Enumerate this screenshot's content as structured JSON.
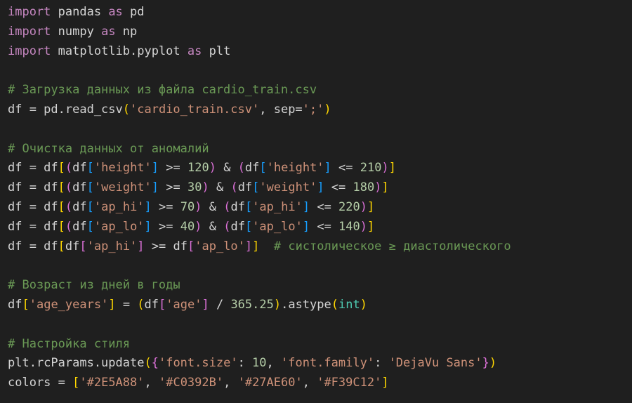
{
  "code": {
    "language": "python",
    "lines": [
      [
        {
          "t": "import",
          "c": "kw"
        },
        {
          "t": " pandas ",
          "c": "id"
        },
        {
          "t": "as",
          "c": "kw"
        },
        {
          "t": " pd",
          "c": "id"
        }
      ],
      [
        {
          "t": "import",
          "c": "kw"
        },
        {
          "t": " numpy ",
          "c": "id"
        },
        {
          "t": "as",
          "c": "kw"
        },
        {
          "t": " np",
          "c": "id"
        }
      ],
      [
        {
          "t": "import",
          "c": "kw"
        },
        {
          "t": " matplotlib.pyplot ",
          "c": "id"
        },
        {
          "t": "as",
          "c": "kw"
        },
        {
          "t": " plt",
          "c": "id"
        }
      ],
      [],
      [
        {
          "t": "# Загрузка данных из файла cardio_train.csv",
          "c": "cm"
        }
      ],
      [
        {
          "t": "df = pd.read_csv",
          "c": "id"
        },
        {
          "t": "(",
          "c": "b1"
        },
        {
          "t": "'cardio_train.csv'",
          "c": "str"
        },
        {
          "t": ", sep=",
          "c": "id"
        },
        {
          "t": "';'",
          "c": "str"
        },
        {
          "t": ")",
          "c": "b1"
        }
      ],
      [],
      [
        {
          "t": "# Очистка данных от аномалий",
          "c": "cm"
        }
      ],
      [
        {
          "t": "df = df",
          "c": "id"
        },
        {
          "t": "[",
          "c": "b1"
        },
        {
          "t": "(",
          "c": "b2"
        },
        {
          "t": "df",
          "c": "id"
        },
        {
          "t": "[",
          "c": "b3"
        },
        {
          "t": "'height'",
          "c": "str"
        },
        {
          "t": "]",
          "c": "b3"
        },
        {
          "t": " >= ",
          "c": "op"
        },
        {
          "t": "120",
          "c": "num"
        },
        {
          "t": ")",
          "c": "b2"
        },
        {
          "t": " & ",
          "c": "op"
        },
        {
          "t": "(",
          "c": "b2"
        },
        {
          "t": "df",
          "c": "id"
        },
        {
          "t": "[",
          "c": "b3"
        },
        {
          "t": "'height'",
          "c": "str"
        },
        {
          "t": "]",
          "c": "b3"
        },
        {
          "t": " <= ",
          "c": "op"
        },
        {
          "t": "210",
          "c": "num"
        },
        {
          "t": ")",
          "c": "b2"
        },
        {
          "t": "]",
          "c": "b1"
        }
      ],
      [
        {
          "t": "df = df",
          "c": "id"
        },
        {
          "t": "[",
          "c": "b1"
        },
        {
          "t": "(",
          "c": "b2"
        },
        {
          "t": "df",
          "c": "id"
        },
        {
          "t": "[",
          "c": "b3"
        },
        {
          "t": "'weight'",
          "c": "str"
        },
        {
          "t": "]",
          "c": "b3"
        },
        {
          "t": " >= ",
          "c": "op"
        },
        {
          "t": "30",
          "c": "num"
        },
        {
          "t": ")",
          "c": "b2"
        },
        {
          "t": " & ",
          "c": "op"
        },
        {
          "t": "(",
          "c": "b2"
        },
        {
          "t": "df",
          "c": "id"
        },
        {
          "t": "[",
          "c": "b3"
        },
        {
          "t": "'weight'",
          "c": "str"
        },
        {
          "t": "]",
          "c": "b3"
        },
        {
          "t": " <= ",
          "c": "op"
        },
        {
          "t": "180",
          "c": "num"
        },
        {
          "t": ")",
          "c": "b2"
        },
        {
          "t": "]",
          "c": "b1"
        }
      ],
      [
        {
          "t": "df = df",
          "c": "id"
        },
        {
          "t": "[",
          "c": "b1"
        },
        {
          "t": "(",
          "c": "b2"
        },
        {
          "t": "df",
          "c": "id"
        },
        {
          "t": "[",
          "c": "b3"
        },
        {
          "t": "'ap_hi'",
          "c": "str"
        },
        {
          "t": "]",
          "c": "b3"
        },
        {
          "t": " >= ",
          "c": "op"
        },
        {
          "t": "70",
          "c": "num"
        },
        {
          "t": ")",
          "c": "b2"
        },
        {
          "t": " & ",
          "c": "op"
        },
        {
          "t": "(",
          "c": "b2"
        },
        {
          "t": "df",
          "c": "id"
        },
        {
          "t": "[",
          "c": "b3"
        },
        {
          "t": "'ap_hi'",
          "c": "str"
        },
        {
          "t": "]",
          "c": "b3"
        },
        {
          "t": " <= ",
          "c": "op"
        },
        {
          "t": "220",
          "c": "num"
        },
        {
          "t": ")",
          "c": "b2"
        },
        {
          "t": "]",
          "c": "b1"
        }
      ],
      [
        {
          "t": "df = df",
          "c": "id"
        },
        {
          "t": "[",
          "c": "b1"
        },
        {
          "t": "(",
          "c": "b2"
        },
        {
          "t": "df",
          "c": "id"
        },
        {
          "t": "[",
          "c": "b3"
        },
        {
          "t": "'ap_lo'",
          "c": "str"
        },
        {
          "t": "]",
          "c": "b3"
        },
        {
          "t": " >= ",
          "c": "op"
        },
        {
          "t": "40",
          "c": "num"
        },
        {
          "t": ")",
          "c": "b2"
        },
        {
          "t": " & ",
          "c": "op"
        },
        {
          "t": "(",
          "c": "b2"
        },
        {
          "t": "df",
          "c": "id"
        },
        {
          "t": "[",
          "c": "b3"
        },
        {
          "t": "'ap_lo'",
          "c": "str"
        },
        {
          "t": "]",
          "c": "b3"
        },
        {
          "t": " <= ",
          "c": "op"
        },
        {
          "t": "140",
          "c": "num"
        },
        {
          "t": ")",
          "c": "b2"
        },
        {
          "t": "]",
          "c": "b1"
        }
      ],
      [
        {
          "t": "df = df",
          "c": "id"
        },
        {
          "t": "[",
          "c": "b1"
        },
        {
          "t": "df",
          "c": "id"
        },
        {
          "t": "[",
          "c": "b2"
        },
        {
          "t": "'ap_hi'",
          "c": "str"
        },
        {
          "t": "]",
          "c": "b2"
        },
        {
          "t": " >= ",
          "c": "op"
        },
        {
          "t": "df",
          "c": "id"
        },
        {
          "t": "[",
          "c": "b2"
        },
        {
          "t": "'ap_lo'",
          "c": "str"
        },
        {
          "t": "]",
          "c": "b2"
        },
        {
          "t": "]",
          "c": "b1"
        },
        {
          "t": "  ",
          "c": "id"
        },
        {
          "t": "# систолическое ≥ диастолического",
          "c": "cm"
        }
      ],
      [],
      [
        {
          "t": "# Возраст из дней в годы",
          "c": "cm"
        }
      ],
      [
        {
          "t": "df",
          "c": "id"
        },
        {
          "t": "[",
          "c": "b1"
        },
        {
          "t": "'age_years'",
          "c": "str"
        },
        {
          "t": "]",
          "c": "b1"
        },
        {
          "t": " = ",
          "c": "op"
        },
        {
          "t": "(",
          "c": "b1"
        },
        {
          "t": "df",
          "c": "id"
        },
        {
          "t": "[",
          "c": "b2"
        },
        {
          "t": "'age'",
          "c": "str"
        },
        {
          "t": "]",
          "c": "b2"
        },
        {
          "t": " / ",
          "c": "op"
        },
        {
          "t": "365.25",
          "c": "num"
        },
        {
          "t": ")",
          "c": "b1"
        },
        {
          "t": ".astype",
          "c": "id"
        },
        {
          "t": "(",
          "c": "b1"
        },
        {
          "t": "int",
          "c": "bi"
        },
        {
          "t": ")",
          "c": "b1"
        }
      ],
      [],
      [
        {
          "t": "# Настройка стиля",
          "c": "cm"
        }
      ],
      [
        {
          "t": "plt.rcParams.update",
          "c": "id"
        },
        {
          "t": "(",
          "c": "b1"
        },
        {
          "t": "{",
          "c": "b2"
        },
        {
          "t": "'font.size'",
          "c": "str"
        },
        {
          "t": ": ",
          "c": "op"
        },
        {
          "t": "10",
          "c": "num"
        },
        {
          "t": ", ",
          "c": "op"
        },
        {
          "t": "'font.family'",
          "c": "str"
        },
        {
          "t": ": ",
          "c": "op"
        },
        {
          "t": "'DejaVu Sans'",
          "c": "str"
        },
        {
          "t": "}",
          "c": "b2"
        },
        {
          "t": ")",
          "c": "b1"
        }
      ],
      [
        {
          "t": "colors = ",
          "c": "id"
        },
        {
          "t": "[",
          "c": "b1"
        },
        {
          "t": "'#2E5A88'",
          "c": "str"
        },
        {
          "t": ", ",
          "c": "op"
        },
        {
          "t": "'#C0392B'",
          "c": "str"
        },
        {
          "t": ", ",
          "c": "op"
        },
        {
          "t": "'#27AE60'",
          "c": "str"
        },
        {
          "t": ", ",
          "c": "op"
        },
        {
          "t": "'#F39C12'",
          "c": "str"
        },
        {
          "t": "]",
          "c": "b1"
        }
      ]
    ]
  }
}
